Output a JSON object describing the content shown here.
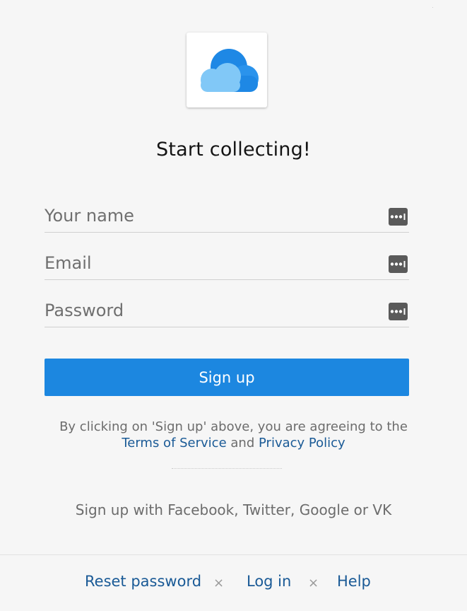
{
  "title": "Start collecting!",
  "form": {
    "name_placeholder": "Your name",
    "email_placeholder": "Email",
    "password_placeholder": "Password"
  },
  "signup_label": "Sign up",
  "terms": {
    "prefix": "By clicking on 'Sign up' above, you are agreeing to the",
    "tos_label": "Terms of Service",
    "and_text": "and",
    "privacy_label": "Privacy Policy"
  },
  "social_text": "Sign up with Facebook, Twitter, Google or VK",
  "footer": {
    "reset_label": "Reset password",
    "separator": "×",
    "login_label": "Log in",
    "help_label": "Help"
  },
  "colors": {
    "accent": "#1c87e0",
    "link": "#1a5a96",
    "cloud_back": "#1e88e5",
    "cloud_front": "#81c8f7"
  },
  "icons": [
    "cloud-logo-icon",
    "password-manager-icon"
  ]
}
